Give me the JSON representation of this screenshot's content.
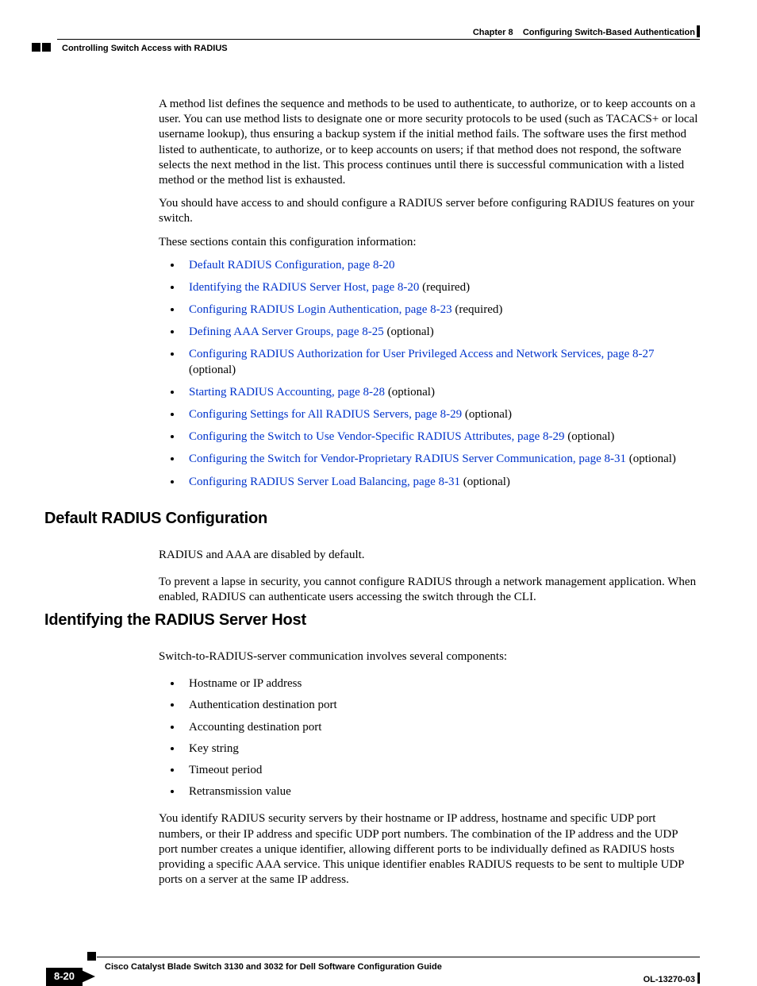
{
  "header": {
    "chapter_label": "Chapter 8",
    "chapter_title": "Configuring Switch-Based Authentication",
    "section_title": "Controlling Switch Access with RADIUS"
  },
  "body": {
    "p1": "A method list defines the sequence and methods to be used to authenticate, to authorize, or to keep accounts on a user. You can use method lists to designate one or more security protocols to be used (such as TACACS+ or local username lookup), thus ensuring a backup system if the initial method fails. The software uses the first method listed to authenticate, to authorize, or to keep accounts on users; if that method does not respond, the software selects the next method in the list. This process continues until there is successful communication with a listed method or the method list is exhausted.",
    "p2": "You should have access to and should configure a RADIUS server before configuring RADIUS features on your switch.",
    "p3": "These sections contain this configuration information:",
    "links": [
      {
        "text": "Default RADIUS Configuration, page 8-20",
        "suffix": ""
      },
      {
        "text": "Identifying the RADIUS Server Host, page 8-20",
        "suffix": " (required)"
      },
      {
        "text": "Configuring RADIUS Login Authentication, page 8-23",
        "suffix": " (required)"
      },
      {
        "text": "Defining AAA Server Groups, page 8-25",
        "suffix": " (optional)"
      },
      {
        "text": "Configuring RADIUS Authorization for User Privileged Access and Network Services, page 8-27",
        "suffix": " (optional)"
      },
      {
        "text": "Starting RADIUS Accounting, page 8-28",
        "suffix": " (optional)"
      },
      {
        "text": "Configuring Settings for All RADIUS Servers, page 8-29",
        "suffix": " (optional)"
      },
      {
        "text": "Configuring the Switch to Use Vendor-Specific RADIUS Attributes, page 8-29",
        "suffix": " (optional)"
      },
      {
        "text": "Configuring the Switch for Vendor-Proprietary RADIUS Server Communication, page 8-31",
        "suffix": " (optional)"
      },
      {
        "text": "Configuring RADIUS Server Load Balancing, page 8-31",
        "suffix": " (optional)"
      }
    ],
    "s1": {
      "heading": "Default RADIUS Configuration",
      "p1": "RADIUS and AAA are disabled by default.",
      "p2": "To prevent a lapse in security, you cannot configure RADIUS through a network management application. When enabled, RADIUS can authenticate users accessing the switch through the CLI."
    },
    "s2": {
      "heading": "Identifying the RADIUS Server Host",
      "p1": "Switch-to-RADIUS-server communication involves several components:",
      "components": [
        "Hostname or IP address",
        "Authentication destination port",
        "Accounting destination port",
        "Key string",
        "Timeout period",
        "Retransmission value"
      ],
      "p2": "You identify RADIUS security servers by their hostname or IP address, hostname and specific UDP port numbers, or their IP address and specific UDP port numbers. The combination of the IP address and the UDP port number creates a unique identifier, allowing different ports to be individually defined as RADIUS hosts providing a specific AAA service. This unique identifier enables RADIUS requests to be sent to multiple UDP ports on a server at the same IP address."
    }
  },
  "footer": {
    "book_title": "Cisco Catalyst Blade Switch 3130 and 3032 for Dell Software Configuration Guide",
    "page_number": "8-20",
    "doc_id": "OL-13270-03"
  }
}
